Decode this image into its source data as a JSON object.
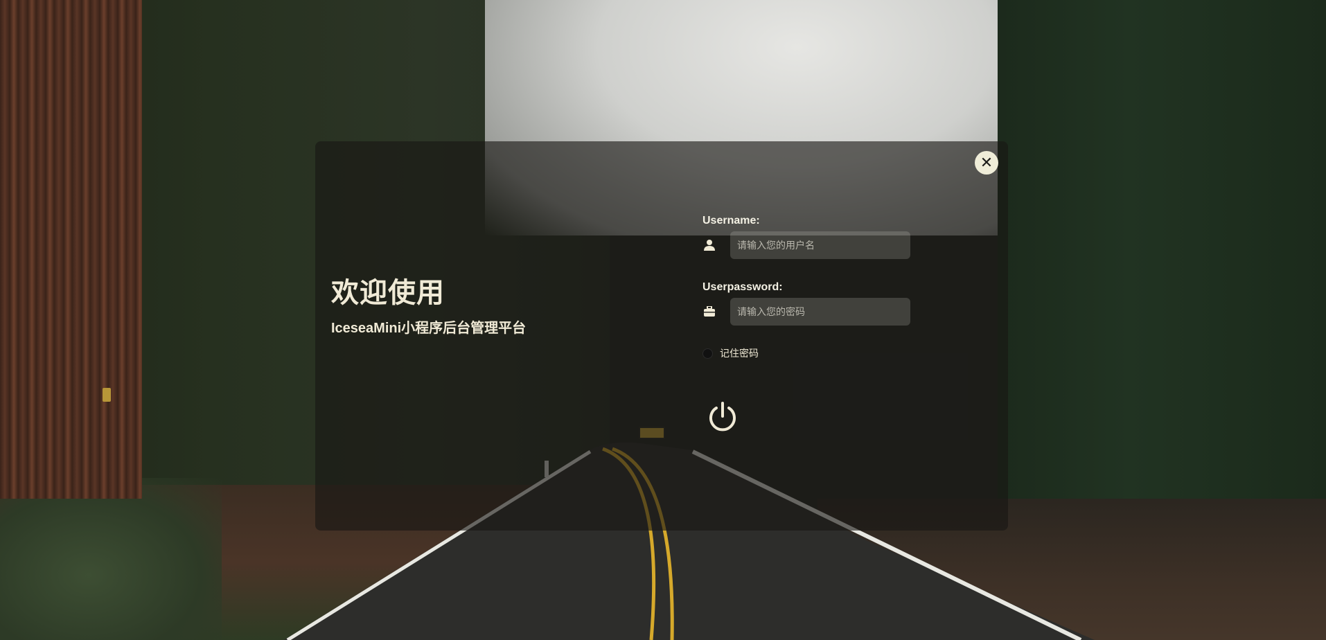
{
  "header": {
    "welcome": "欢迎使用",
    "subtitle": "IceseaMini小程序后台管理平台"
  },
  "form": {
    "username": {
      "label": "Username:",
      "placeholder": "请输入您的用户名",
      "icon": "user-icon",
      "value": ""
    },
    "password": {
      "label": "Userpassword:",
      "placeholder": "请输入您的密码",
      "icon": "briefcase-icon",
      "value": ""
    },
    "remember": {
      "label": "记住密码",
      "checked": false
    }
  },
  "buttons": {
    "close": {
      "symbol": "✕",
      "icon": "close-icon"
    },
    "login": {
      "icon": "power-icon"
    }
  },
  "colors": {
    "text_primary": "#f0ead6",
    "close_bg": "#efedd8",
    "card_bg": "rgba(24,22,20,0.62)"
  }
}
